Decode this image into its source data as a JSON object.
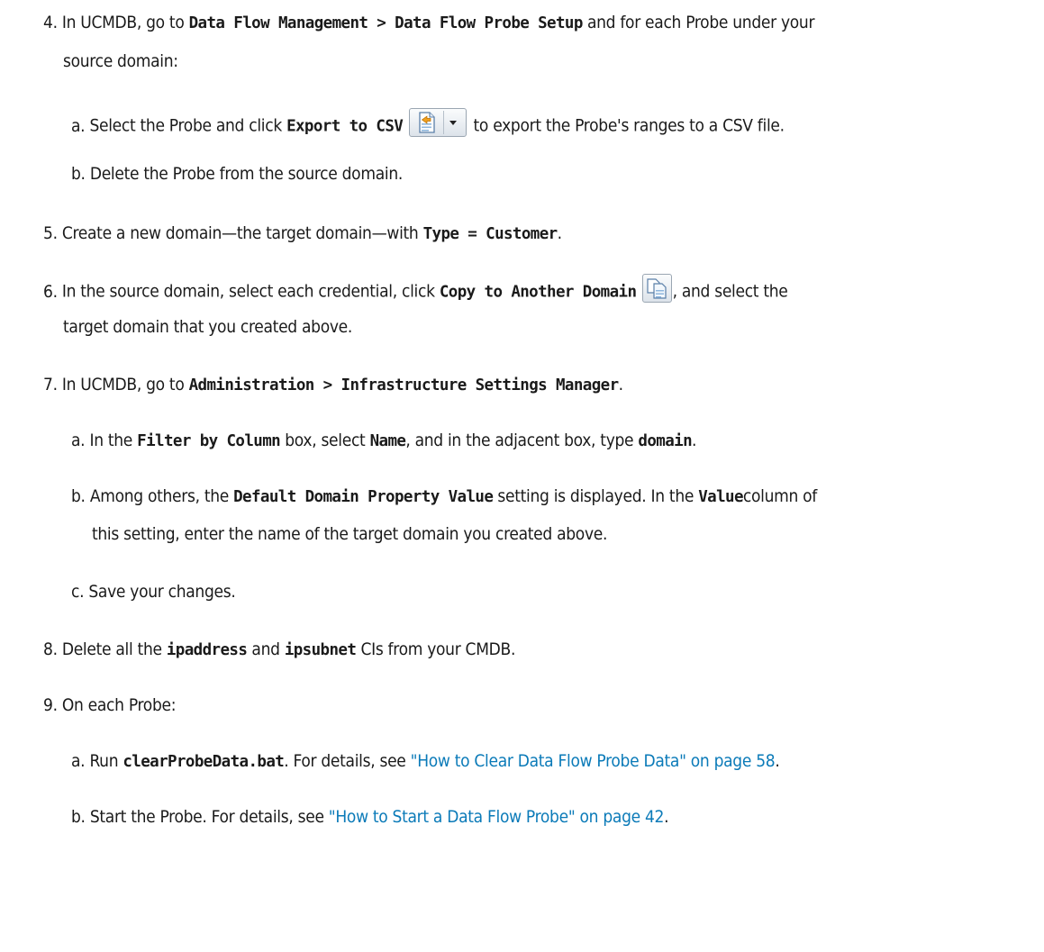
{
  "steps": {
    "s4": {
      "num": "4.",
      "t1": "In UCMDB, go to ",
      "b1": "Data Flow Management > Data Flow Probe Setup",
      "t2": " and for each Probe under your",
      "t3": "source domain:",
      "a": {
        "num": "a.",
        "t1": "Select the Probe and click ",
        "b1": "Export to CSV",
        "t2": " to export the Probe's ranges to a CSV file."
      },
      "b": {
        "num": "b.",
        "t1": "Delete the Probe from the source domain."
      }
    },
    "s5": {
      "num": "5.",
      "t1": "Create a new domain—the target domain—with ",
      "b1": "Type = Customer",
      "t2": "."
    },
    "s6": {
      "num": "6.",
      "t1": "In the source domain, select each credential, click ",
      "b1": "Copy to Another Domain",
      "t2": ", and select the",
      "t3": "target domain that you created above."
    },
    "s7": {
      "num": "7.",
      "t1": "In UCMDB, go to ",
      "b1": "Administration > Infrastructure Settings Manager",
      "t2": ".",
      "a": {
        "num": "a.",
        "t1": "In the ",
        "b1": "Filter by Column",
        "t2": " box, select ",
        "b2": "Name",
        "t3": ", and in the adjacent box, type ",
        "b3": "domain",
        "t4": "."
      },
      "b": {
        "num": "b.",
        "t1": "Among others, the ",
        "b1": "Default Domain Property Value",
        "t2": " setting is displayed. In the ",
        "b2": "Value",
        "t3": "column of",
        "t4": "this setting, enter the name of the target domain you created above."
      },
      "c": {
        "num": "c.",
        "t1": "Save your changes."
      }
    },
    "s8": {
      "num": "8.",
      "t1": "Delete all the ",
      "b1": "ipaddress",
      "t2": " and ",
      "b2": "ipsubnet",
      "t3": " CIs from your CMDB."
    },
    "s9": {
      "num": "9.",
      "t1": "On each Probe:",
      "a": {
        "num": "a.",
        "t1": "Run ",
        "b1": "clearProbeData.bat",
        "t2": ". For details, see ",
        "link": "\"How to Clear Data Flow Probe Data\" on page 58",
        "t3": "."
      },
      "b": {
        "num": "b.",
        "t1": "Start the Probe. For details, see ",
        "link": "\"How to Start a Data Flow Probe\" on page 42",
        "t2": "."
      }
    }
  },
  "icons": {
    "export_button": "export-to-csv-icon",
    "copy_button": "copy-to-another-domain-icon"
  },
  "colors": {
    "link": "#0a7ab8",
    "text": "#1a1a1a"
  }
}
